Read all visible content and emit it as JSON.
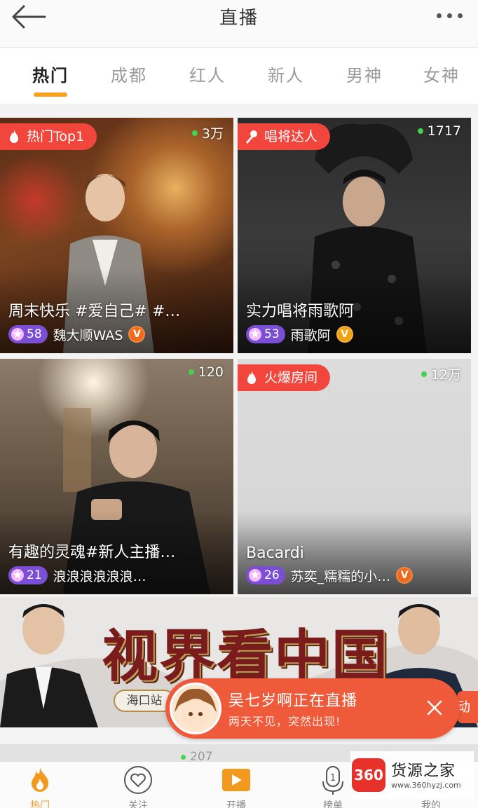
{
  "header": {
    "title": "直播"
  },
  "tabs": [
    {
      "label": "热门"
    },
    {
      "label": "成都"
    },
    {
      "label": "红人"
    },
    {
      "label": "新人"
    },
    {
      "label": "男神"
    },
    {
      "label": "女神"
    }
  ],
  "active_tab": "热门",
  "cards": [
    {
      "badge": "热门Top1",
      "badge_icon": "flame-icon",
      "viewers": "3万",
      "title": "周末快乐 #爱自己# #…",
      "level": "58",
      "user": "魏大顺WAS",
      "verified": "V"
    },
    {
      "badge": "唱将达人",
      "badge_icon": "microphone-icon",
      "viewers": "1717",
      "title": "实力唱将雨歌阿",
      "level": "53",
      "user": "雨歌阿",
      "verified": "V"
    },
    {
      "badge": "",
      "badge_icon": "",
      "viewers": "120",
      "title": "有趣的灵魂#新人主播…",
      "level": "21",
      "user": "浪浪浪浪浪浪…",
      "verified": ""
    },
    {
      "badge": "火爆房间",
      "badge_icon": "flame-icon",
      "viewers": "12万",
      "title": "Bacardi",
      "level": "26",
      "user": "苏奕_糯糯的小…",
      "verified": "V"
    }
  ],
  "banner": {
    "title": "视界看中国",
    "tag": "海口站"
  },
  "live_notice": {
    "title": "吴七岁啊正在直播",
    "subtitle": "两天不见，突然出现!",
    "side_label": "动"
  },
  "next_row_viewers": "207",
  "bottom_nav": [
    {
      "label": "热门",
      "icon": "flame-icon"
    },
    {
      "label": "关注",
      "icon": "heart-icon"
    },
    {
      "label": "开播",
      "icon": "camera-icon"
    },
    {
      "label": "榜单",
      "icon": "rank-icon"
    },
    {
      "label": "我的",
      "icon": "user-icon"
    }
  ],
  "watermark": {
    "logo": "360",
    "name": "货源之家",
    "url": "www.360hyzj.com"
  },
  "colors": {
    "accent": "#f39a1e",
    "badge_red": "#f2453c",
    "online_green": "#45d04f",
    "level_purple": "#7a4fd6"
  }
}
